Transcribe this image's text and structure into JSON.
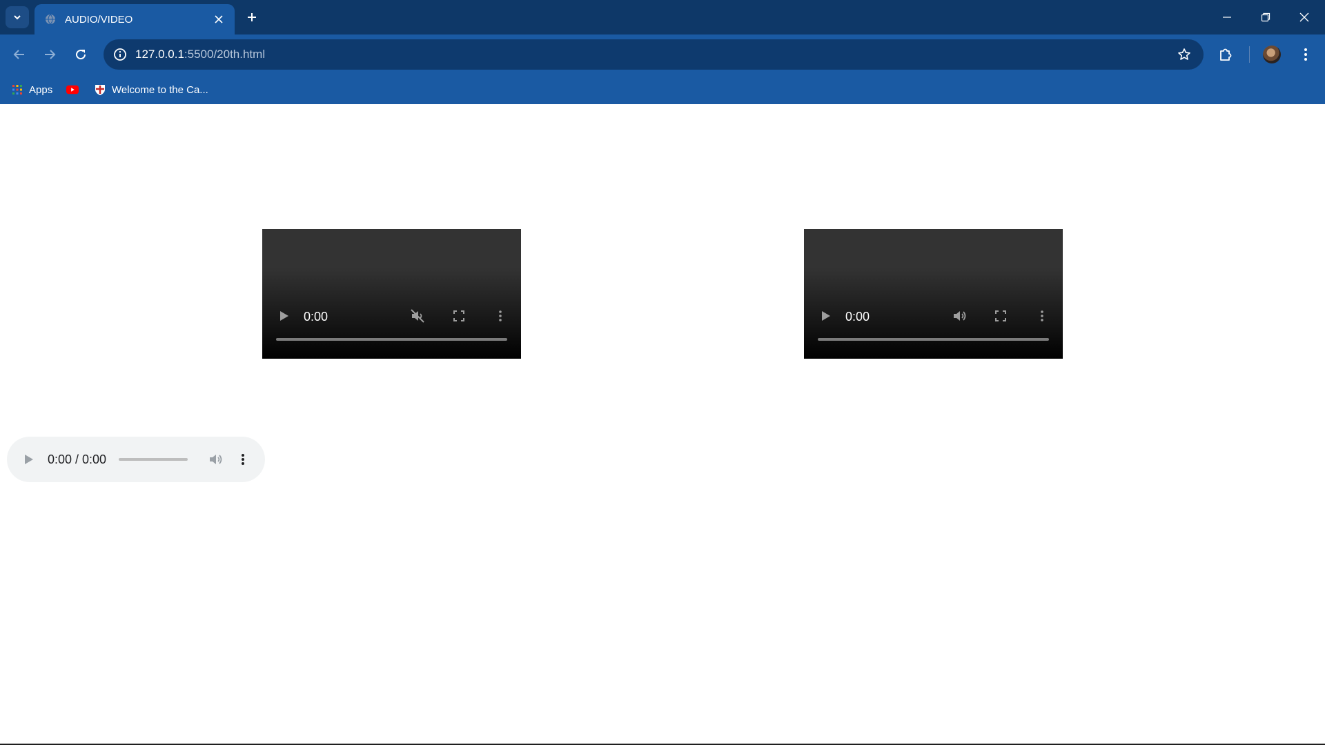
{
  "browser": {
    "tab": {
      "title": "AUDIO/VIDEO",
      "favicon": "globe-icon"
    },
    "address_bar": {
      "host": "127.0.0.1",
      "path": ":5500/20th.html"
    },
    "bookmarks": [
      {
        "label": "Apps",
        "icon": "apps-grid-icon"
      },
      {
        "label": "",
        "icon": "youtube-icon"
      },
      {
        "label": "Welcome to the Ca...",
        "icon": "site-shield-icon"
      }
    ],
    "colors": {
      "tabstrip": "#0e3868",
      "toolbar": "#1a5aa3",
      "omnibox": "#0e3a6e"
    }
  },
  "page": {
    "videos": [
      {
        "time": "0:00",
        "volume_icon": "volume-muted-icon",
        "muted": true
      },
      {
        "time": "0:00",
        "volume_icon": "volume-icon",
        "muted": false
      }
    ],
    "audio": {
      "time": "0:00 / 0:00",
      "progress": 0
    }
  }
}
